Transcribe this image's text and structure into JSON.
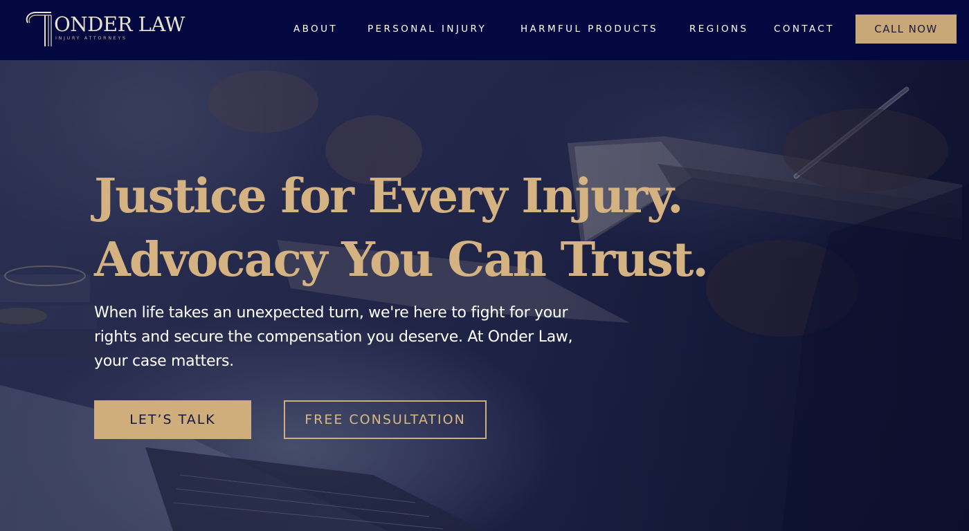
{
  "brand": {
    "name": "ONDER LAW",
    "tagline": "INJURY ATTORNEYS",
    "accent_color": "#c9a877",
    "nav_bg_color": "#030940"
  },
  "nav": {
    "items": [
      {
        "label": "ABOUT"
      },
      {
        "label": "PERSONAL INJURY"
      },
      {
        "label": "HARMFUL PRODUCTS"
      },
      {
        "label": "REGIONS"
      },
      {
        "label": "CONTACT"
      }
    ],
    "cta_label": "CALL NOW"
  },
  "hero": {
    "headline_line1": "Justice for Every Injury.",
    "headline_line2": "Advocacy You Can Trust.",
    "body": "When life takes an unexpected turn, we're here to fight for your rights and secure the compensation you deserve. At Onder Law, your case matters.",
    "primary_cta": "LET’S TALK",
    "secondary_cta": "FREE CONSULTATION",
    "headline_color": "#d4b281"
  }
}
